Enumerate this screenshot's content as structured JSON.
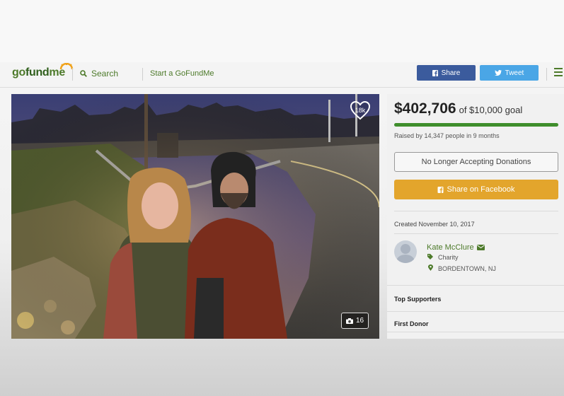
{
  "brand": {
    "logo_left": "go",
    "logo_mid": "fund",
    "logo_right": "me",
    "color": "#4d7a2a"
  },
  "nav": {
    "search_label": "Search",
    "start_label": "Start a GoFundMe",
    "share_label": "Share",
    "tweet_label": "Tweet",
    "share_icon": "facebook-icon",
    "tweet_icon": "twitter-icon",
    "menu_icon": "hamburger-menu-icon"
  },
  "photo": {
    "likes": "18k",
    "photo_count": "16"
  },
  "campaign": {
    "raised": "$402,706",
    "goal_text": "of $10,000 goal",
    "progress_fraction": 1.0,
    "raised_by": "Raised by 14,347 people in 9 months",
    "status_button": "No Longer Accepting Donations",
    "fb_button": "Share on Facebook",
    "created": "Created November 10, 2017"
  },
  "organizer": {
    "name": "Kate McClure",
    "category": "Charity",
    "location": "BORDENTOWN, NJ"
  },
  "sections": {
    "top_supporters": "Top Supporters",
    "first_donor": "First Donor"
  },
  "colors": {
    "facebook": "#3b5b9d",
    "twitter": "#4aa6e6",
    "progress": "#3f8e2c",
    "fb_share": "#e3a52c"
  }
}
